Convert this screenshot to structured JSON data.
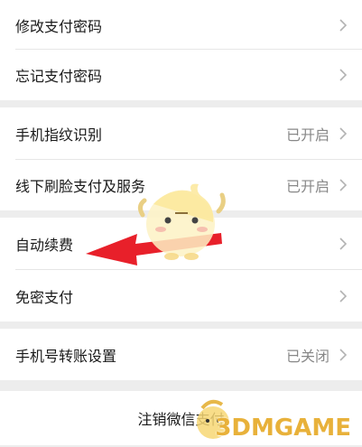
{
  "settings": {
    "group1": [
      {
        "label": "修改支付密码"
      },
      {
        "label": "忘记支付密码"
      }
    ],
    "group2": [
      {
        "label": "手机指纹识别",
        "value": "已开启"
      },
      {
        "label": "线下刷脸支付及服务",
        "value": "已开启"
      }
    ],
    "group3": [
      {
        "label": "自动续费"
      },
      {
        "label": "免密支付"
      }
    ],
    "group4": [
      {
        "label": "手机号转账设置",
        "value": "已关闭"
      }
    ],
    "cancel_label": "注销微信支付"
  },
  "icons": {
    "chevron": "chevron-right-icon"
  },
  "annotation": {
    "arrow_color": "#e8202a"
  },
  "watermark": {
    "text": "3DMGAME"
  }
}
